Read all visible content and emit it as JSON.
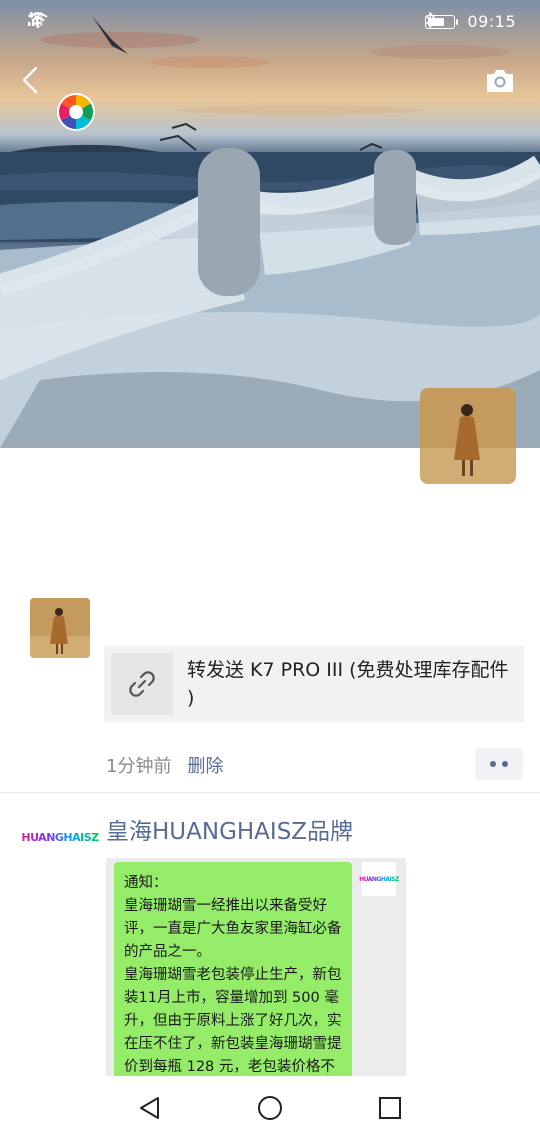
{
  "status_bar": {
    "network": "4G",
    "time": "09:15",
    "battery_level": 0.55,
    "icons": [
      "signal-icon",
      "wifi-icon",
      "bluetooth-icon",
      "battery-icon"
    ]
  },
  "header": {
    "back_icon": "chevron-left-icon",
    "camera_icon": "camera-icon",
    "app_icon": "shutter-icon"
  },
  "posts": [
    {
      "link_title": "转发送 K7 PRO III (免费处理库存配件 )",
      "time_ago": "1分钟前",
      "delete_label": "删除"
    },
    {
      "author": "皇海HUANGHAISZ品牌",
      "logo_text": "HUANGHAISZ",
      "notice_text": "通知：\n皇海珊瑚雪一经推出以来备受好评，一直是广大鱼友家里海缸必备的产品之一。\n皇海珊瑚雪老包装停止生产，新包装11月上市，容量增加到 500 毫升，但由于原料上涨了好几次，实在压不住了，新包装皇海珊瑚雪提价到每瓶 128 元，老包装价格不变，老包装部分近期产品没有外纸"
    }
  ],
  "nav": {
    "back_icon": "triangle-back-icon",
    "home_icon": "circle-home-icon",
    "recents_icon": "square-recents-icon"
  },
  "colors": {
    "link_blue": "#576b95",
    "bubble_green": "#95ec69",
    "meta_gray": "#8a8a8a"
  }
}
